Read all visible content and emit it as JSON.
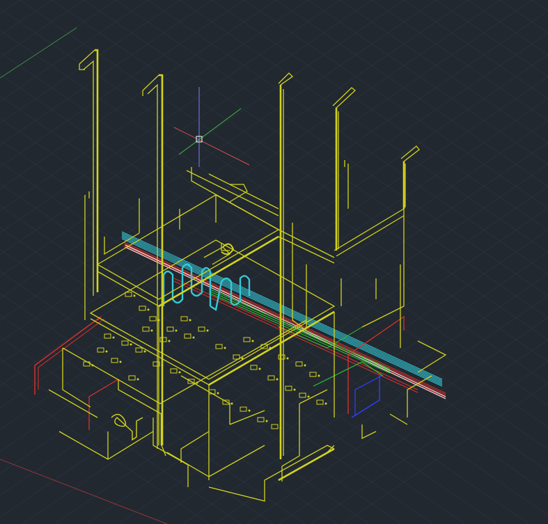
{
  "viewport": {
    "background": "#212830",
    "grid_color": "#2c3440",
    "axis_colors": {
      "x": "#b23a3a",
      "y": "#3a9a3a",
      "z": "#5a5aff"
    },
    "ucs_cursor": {
      "x_axis_color": "#d05050",
      "y_axis_color": "#40c040",
      "z_axis_color": "#7a7aff",
      "pickbox_color": "#ffffff"
    },
    "layer_colors": {
      "main_piping": "#d4d41c",
      "cold_water": "#33c9d6",
      "hot_water": "#e0302a",
      "green_lines": "#2fc72f",
      "blue_lines": "#3040ff",
      "white_lines": "#f0f0f0"
    }
  }
}
